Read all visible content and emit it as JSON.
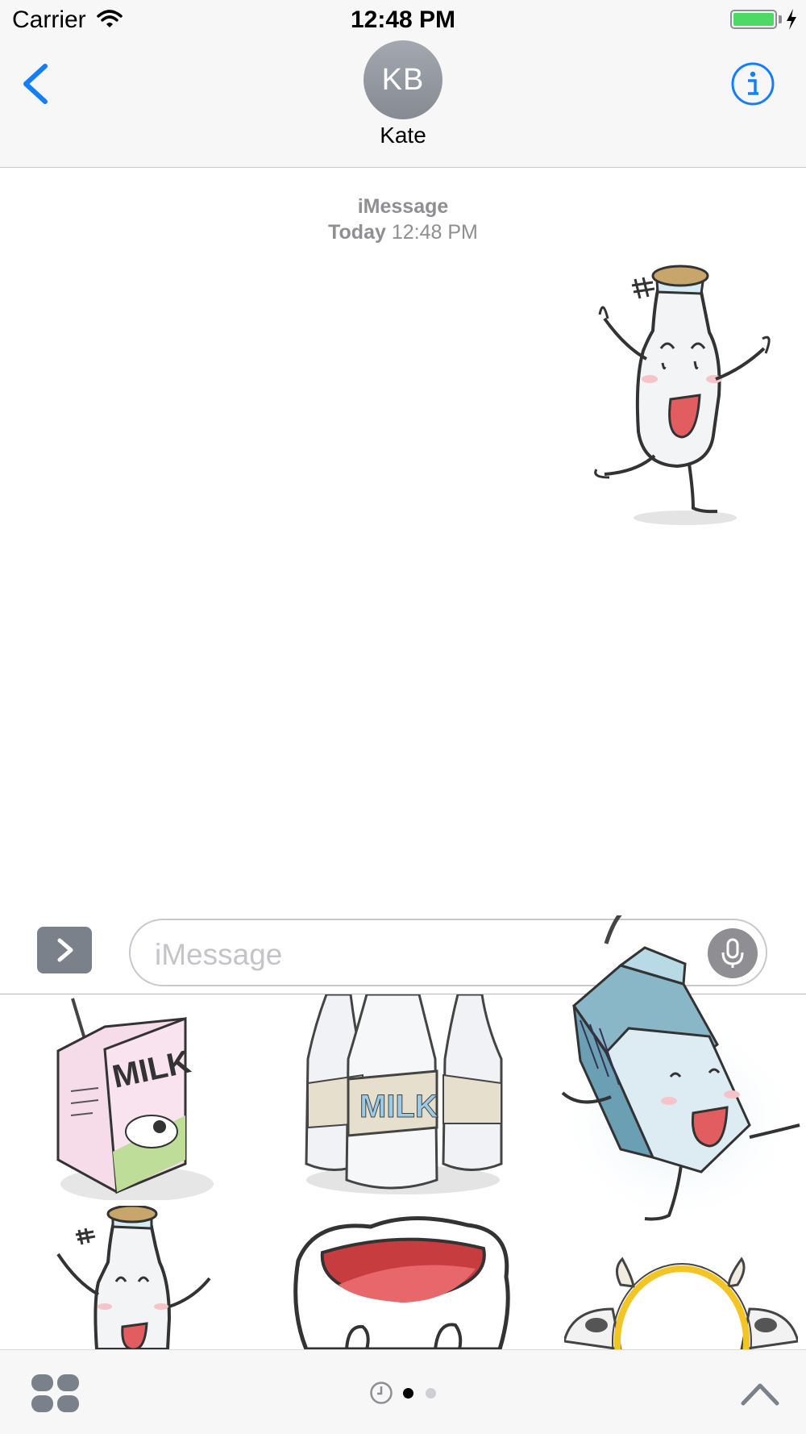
{
  "status_bar": {
    "carrier": "Carrier",
    "time": "12:48 PM",
    "battery_color": "#4cd964"
  },
  "nav": {
    "avatar_initials": "KB",
    "contact_name": "Kate",
    "accent_color": "#157efb"
  },
  "conversation": {
    "service": "iMessage",
    "date_label": "Today",
    "time_label": "12:48 PM"
  },
  "input": {
    "placeholder": "iMessage"
  },
  "sticker_drawer": {
    "stickers": [
      {
        "name": "milk-carton-sticker",
        "text": "MILK"
      },
      {
        "name": "milk-bottles-sticker",
        "text": "MILK"
      },
      {
        "name": "dancing-carton-sticker"
      },
      {
        "name": "milk-bottle-sticker"
      },
      {
        "name": "milk-splash-sticker"
      },
      {
        "name": "cow-frame-sticker"
      }
    ]
  },
  "bottom_bar": {
    "page_count": 2,
    "active_page": 1
  },
  "icons": [
    "wifi-icon",
    "bolt-icon",
    "back-chevron-icon",
    "info-icon",
    "expand-chevron-icon",
    "microphone-icon",
    "apps-icon",
    "recents-clock-icon",
    "collapse-chevron-icon"
  ]
}
